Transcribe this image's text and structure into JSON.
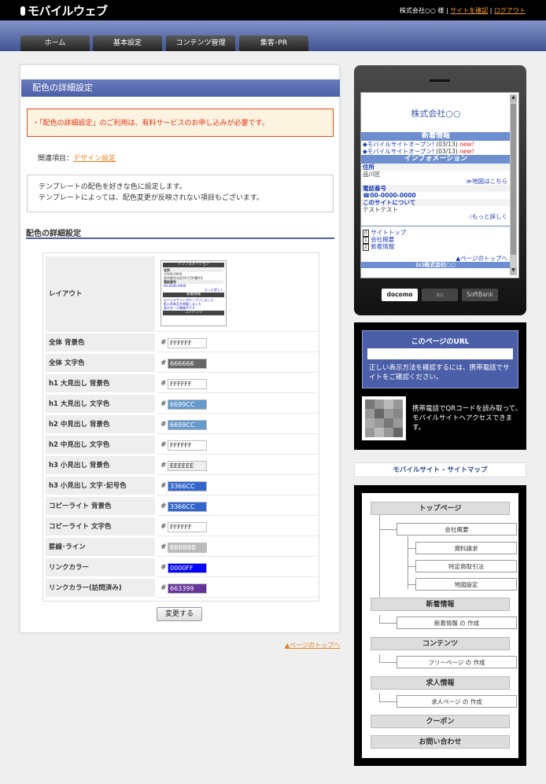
{
  "header": {
    "logo": "モバイルウェブ",
    "account": "株式会社○○ 様",
    "link_site": "サイトを確認",
    "link_logout": "ログアウト"
  },
  "nav": {
    "tabs": [
      "ホーム",
      "基本設定",
      "コンテンツ管理",
      "集客･PR"
    ]
  },
  "main": {
    "title": "配色の詳細設定",
    "alert": "「配色の詳細設定」のご利用は、有料サービスのお申し込みが必要です。",
    "related_label": "関連項目：",
    "related_link": "デザイン設定",
    "desc_line1": "テンプレートの配色を好きな色に設定します。",
    "desc_line2": "テンプレートによっては、配色変更が反映されない項目もございます。",
    "section_heading": "配色の詳細設定",
    "layout_label": "レイアウト",
    "hash": "#",
    "color_rows": [
      {
        "label": "全体 背景色",
        "value": "FFFFFF",
        "color": "#FFFFFF",
        "text_color": "#333333"
      },
      {
        "label": "全体 文字色",
        "value": "666666",
        "color": "#666666",
        "text_color": "#FFFFFF"
      },
      {
        "label": "h1 大見出し 背景色",
        "value": "FFFFFF",
        "color": "#FFFFFF",
        "text_color": "#333333"
      },
      {
        "label": "h1 大見出し 文字色",
        "value": "6699CC",
        "color": "#6699CC",
        "text_color": "#FFFFFF"
      },
      {
        "label": "h2 中見出し 背景色",
        "value": "6699CC",
        "color": "#6699CC",
        "text_color": "#FFFFFF"
      },
      {
        "label": "h2 中見出し 文字色",
        "value": "FFFFFF",
        "color": "#FFFFFF",
        "text_color": "#333333"
      },
      {
        "label": "h3 小見出し 背景色",
        "value": "EEEEEE",
        "color": "#EEEEEE",
        "text_color": "#333333"
      },
      {
        "label": "h3 小見出し 文字･記号色",
        "value": "3366CC",
        "color": "#3366CC",
        "text_color": "#FFFFFF"
      },
      {
        "label": "コピーライト 背景色",
        "value": "3366CC",
        "color": "#3366CC",
        "text_color": "#FFFFFF"
      },
      {
        "label": "コピーライト 文字色",
        "value": "FFFFFF",
        "color": "#FFFFFF",
        "text_color": "#333333"
      },
      {
        "label": "罫線･ライン",
        "value": "BBBBBB",
        "color": "#BBBBBB",
        "text_color": "#FFFFFF"
      },
      {
        "label": "リンクカラー",
        "value": "0000FF",
        "color": "#0000FF",
        "text_color": "#FFFFFF"
      },
      {
        "label": "リンクカラー(訪問済み)",
        "value": "663399",
        "color": "#663399",
        "text_color": "#FFFFFF"
      }
    ],
    "submit_label": "変更する",
    "page_top": "▲ページのトップへ"
  },
  "layout_thumb": {
    "bar1": "インフォメーション",
    "lbl1": "住所",
    "line1": "〒000-0000",
    "line2": "東京都渋谷区00丁目0番0号",
    "lbl2": "電話番号",
    "line3": "00-0000-0000",
    "more": "もっと詳しく",
    "bar2": "新着情報",
    "news1": "モバイルサイトがオープンしました",
    "news2": "新入荷商品を掲載しました",
    "news3": "夏のセール開催中です",
    "bar3": "コンテンツ"
  },
  "phone": {
    "company": "株式会社○○",
    "news_bar": "新着情報",
    "news": [
      {
        "title": "モバイルサイトオープン!",
        "date": "(03/13)",
        "badge": "new!"
      },
      {
        "title": "モバイルサイトオープン!",
        "date": "(03/13)",
        "badge": "new!"
      }
    ],
    "info_bar": "インフォメーション",
    "addr_label": "住所",
    "addr_value": "品川区",
    "map_link": "≫地図はこちら",
    "tel_label": "電話番号",
    "tel_value": "00-0000-0000",
    "about_label": "このサイトについて",
    "about_value": "テストテスト",
    "more_link": "もっと詳しく",
    "menu": [
      {
        "num": "0",
        "label": "サイトトップ"
      },
      {
        "num": "1",
        "label": "会社概要"
      },
      {
        "num": "2",
        "label": "新着情報"
      }
    ],
    "page_top": "▲ページのトップへ",
    "footer": "(c)株式会社○○",
    "carriers": [
      "docomo",
      "au",
      "SoftBank"
    ]
  },
  "url_box": {
    "title": "このページのURL",
    "note": "正しい表示方法を確認するには、携帯電話でサイトをご確認ください。",
    "qr_note": "携帯電話でQRコードを読み取って、モバイルサイトへアクセスできます。"
  },
  "sitemap": {
    "heading": "モバイルサイト - サイトマップ",
    "top": "トップページ",
    "company": "会社概要",
    "docs": "資料請求",
    "law": "特定商取引法",
    "map": "地図設定",
    "news": "新着情報",
    "news_create": "新着情報 の 作成",
    "contents": "コンテンツ",
    "free_page": "フリーページ の 作成",
    "jobs": "求人情報",
    "jobs_create": "求人ページ の 作成",
    "coupon": "クーポン",
    "contact": "お問い合わせ"
  }
}
